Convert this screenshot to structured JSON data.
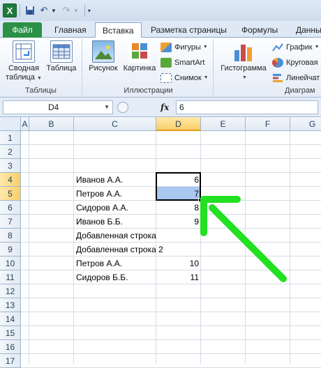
{
  "qat": {
    "app_icon": "X"
  },
  "tabs": [
    {
      "label": "Файл"
    },
    {
      "label": "Главная"
    },
    {
      "label": "Вставка"
    },
    {
      "label": "Разметка страницы"
    },
    {
      "label": "Формулы"
    },
    {
      "label": "Данны"
    }
  ],
  "ribbon": {
    "groups": {
      "tables": "Таблицы",
      "illustrations": "Иллюстрации",
      "charts": "Диаграм"
    },
    "pivot_line1": "Сводная",
    "pivot_line2": "таблица",
    "table": "Таблица",
    "picture": "Рисунок",
    "clipart": "Картинка",
    "shapes": "Фигуры",
    "smartart": "SmartArt",
    "screenshot": "Снимок",
    "histogram": "Гистограмма",
    "graph": "График",
    "pie": "Круговая",
    "linear": "Линейчат"
  },
  "formula_bar": {
    "name_box": "D4",
    "fx": "fx",
    "value": "6"
  },
  "columns": [
    "A",
    "B",
    "C",
    "D",
    "E",
    "F",
    "G"
  ],
  "rows": [
    "1",
    "2",
    "3",
    "4",
    "5",
    "6",
    "7",
    "8",
    "9",
    "10",
    "11",
    "12",
    "13",
    "14",
    "15",
    "16",
    "17"
  ],
  "cells": {
    "C4": "Иванов А.А.",
    "D4": "6",
    "C5": "Петров А.А.",
    "D5": "7",
    "C6": "Сидоров А.А.",
    "D6": "8",
    "C7": "Иванов Б.Б.",
    "D7": "9",
    "C8": "Добавленная строка",
    "C9": "Добавленная строка 2",
    "C10": "Петров А.А.",
    "D10": "10",
    "C11": "Сидоров Б.Б.",
    "D11": "11"
  },
  "colors": {
    "arrow": "#22e022",
    "file_tab": "#2b9146",
    "selection": "#a9c7ef"
  }
}
